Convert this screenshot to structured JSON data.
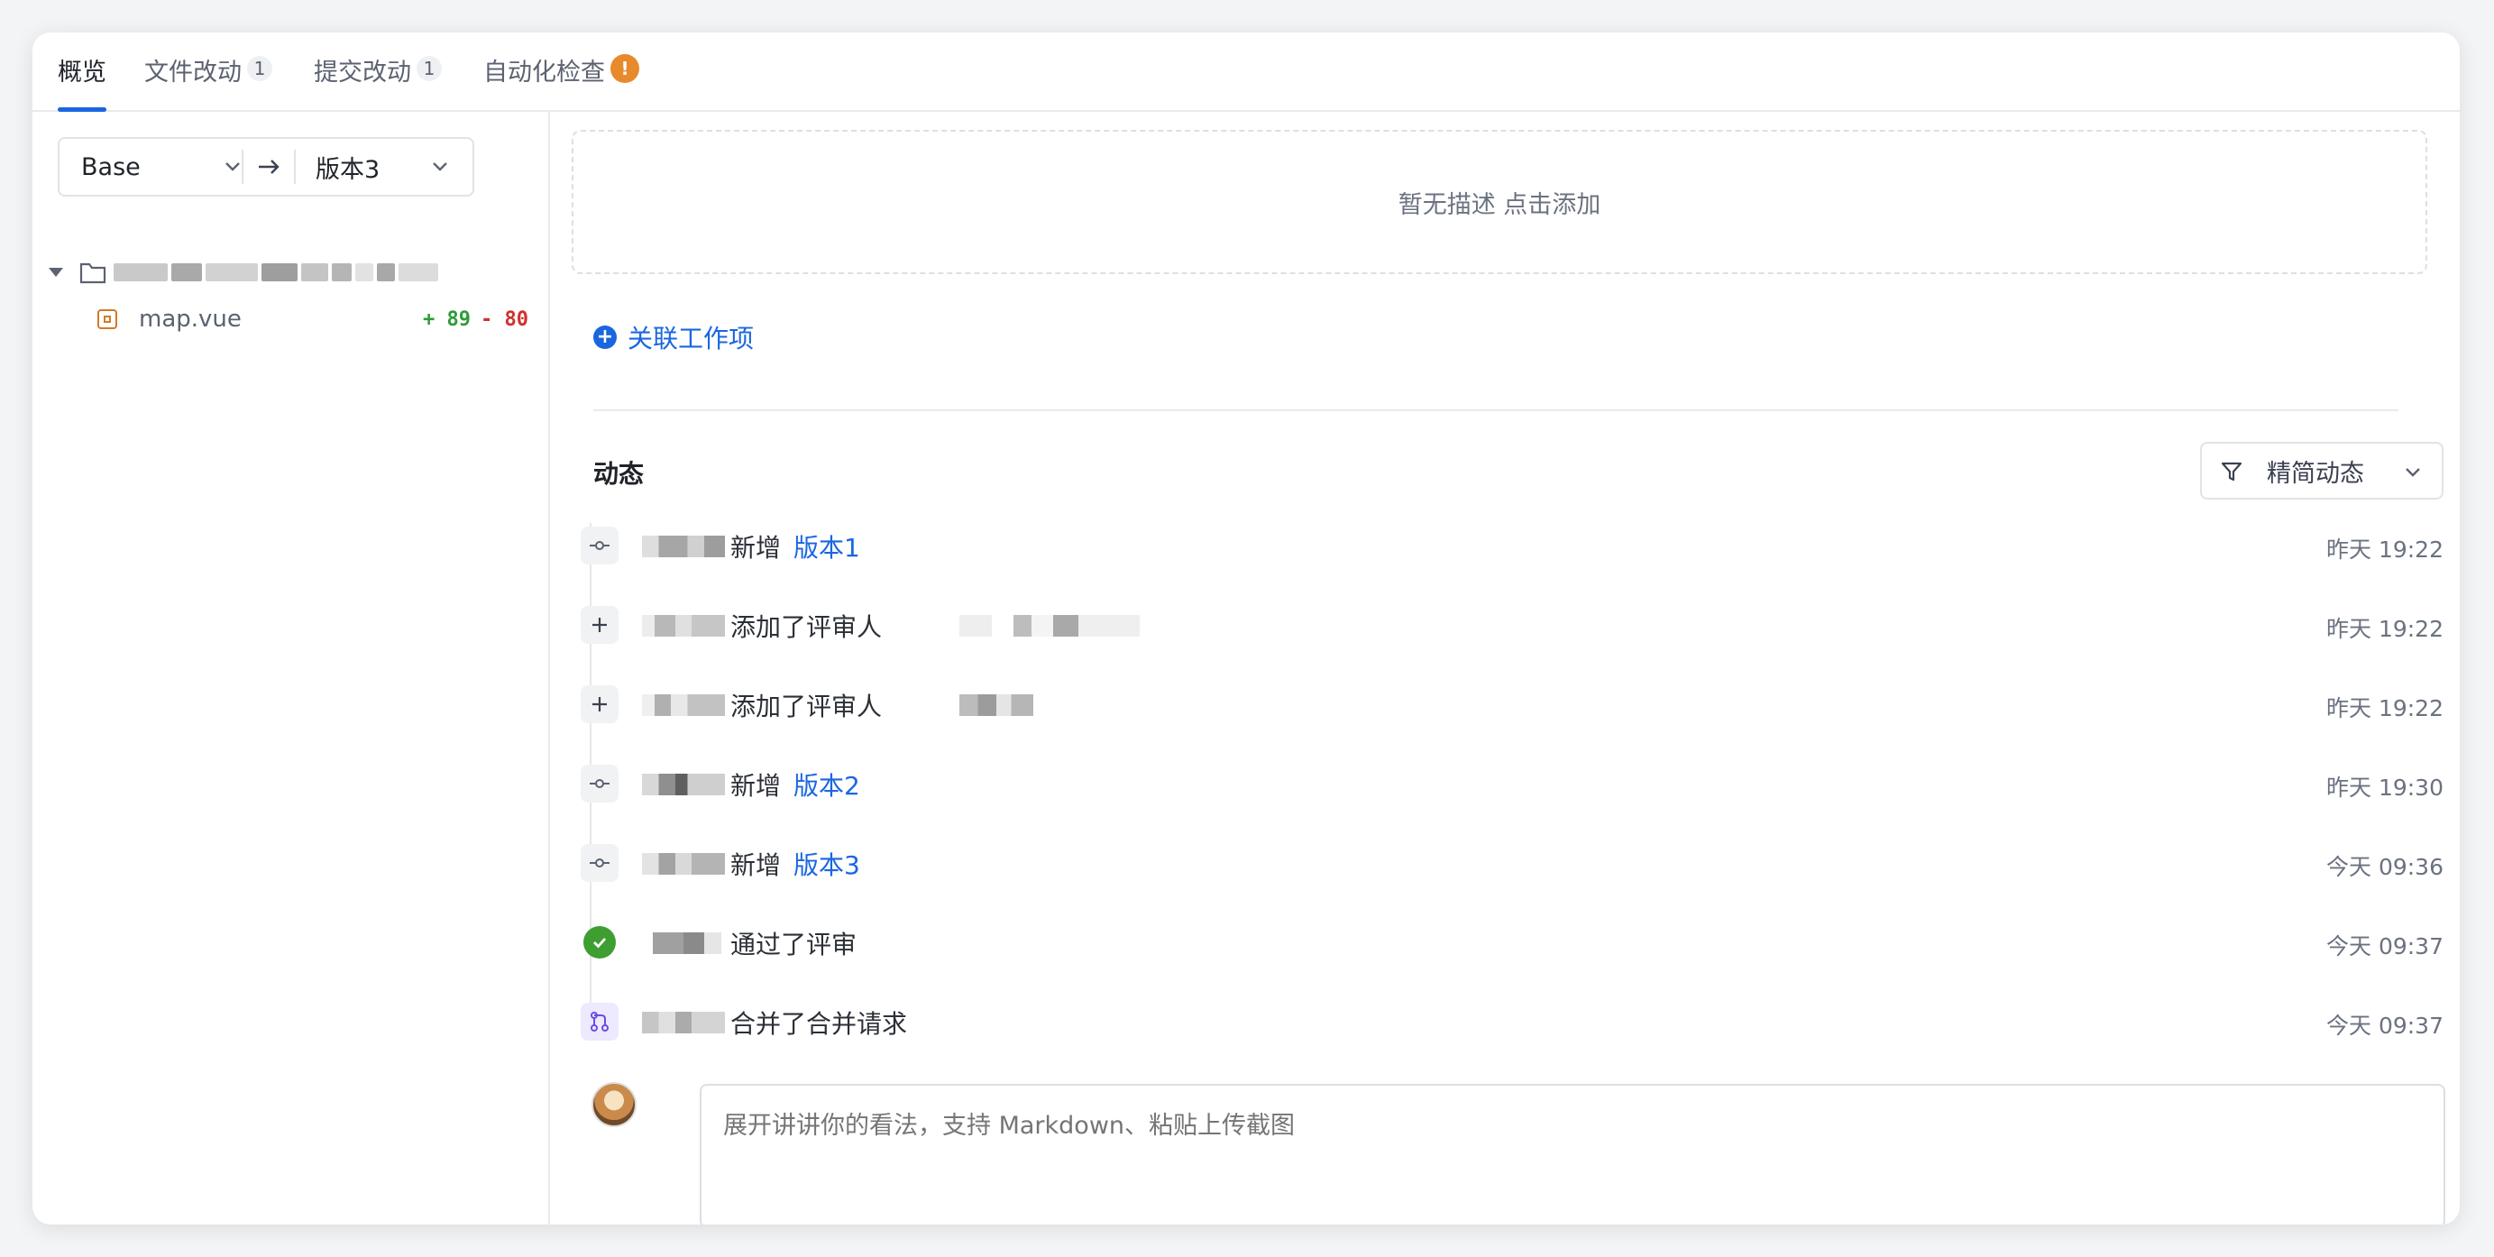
{
  "tabs": [
    {
      "label": "概览"
    },
    {
      "label": "文件改动",
      "count": "1"
    },
    {
      "label": "提交改动",
      "count": "1"
    },
    {
      "label": "自动化检查",
      "badge": "!"
    }
  ],
  "range": {
    "from": "Base",
    "to": "版本3"
  },
  "file_tree": {
    "file": {
      "name": "map.vue",
      "additions": "+ 89",
      "deletions": "- 80"
    }
  },
  "description_placeholder": "暂无描述 点击添加",
  "link_work_item": "关联工作项",
  "activity": {
    "title": "动态",
    "filter_label": "精简动态",
    "events": [
      {
        "type": "commit",
        "action": "新增",
        "link": "版本1",
        "time": "昨天 19:22"
      },
      {
        "type": "add",
        "action": "添加了评审人",
        "link": "",
        "time": "昨天 19:22"
      },
      {
        "type": "add",
        "action": "添加了评审人",
        "link": "",
        "time": "昨天 19:22"
      },
      {
        "type": "commit",
        "action": "新增",
        "link": "版本2",
        "time": "昨天 19:30"
      },
      {
        "type": "commit",
        "action": "新增",
        "link": "版本3",
        "time": "今天 09:36"
      },
      {
        "type": "approved",
        "action": "通过了评审",
        "link": "",
        "time": "今天 09:37"
      },
      {
        "type": "merge",
        "action": "合并了合并请求",
        "link": "",
        "time": "今天 09:37"
      }
    ]
  },
  "comment_placeholder": "展开讲讲你的看法，支持 Markdown、粘贴上传截图",
  "colors": {
    "accent": "#1a66e0",
    "additions": "#2e9b3a",
    "deletions": "#d0312d",
    "warning": "#e8892b",
    "approved": "#3f9e32"
  }
}
